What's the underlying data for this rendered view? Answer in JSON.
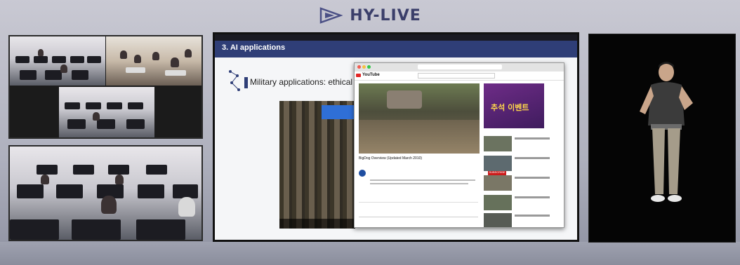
{
  "header": {
    "logo_text": "HY-LIVE",
    "logo_icon": "play-triangle-icon"
  },
  "colors": {
    "slide_header": "#2f3e77",
    "youtube_red": "#cc1b1b",
    "logo": "#3a3e6a"
  },
  "slide": {
    "title": "3. AI applications",
    "heading": "Military applications: ethical i"
  },
  "youtube": {
    "logo": "YouTube",
    "video_title": "BigDog Overview (Updated March 2010)",
    "subscribe_label": "SUBSCRIBE",
    "ad_text": "추석 이벤트"
  }
}
